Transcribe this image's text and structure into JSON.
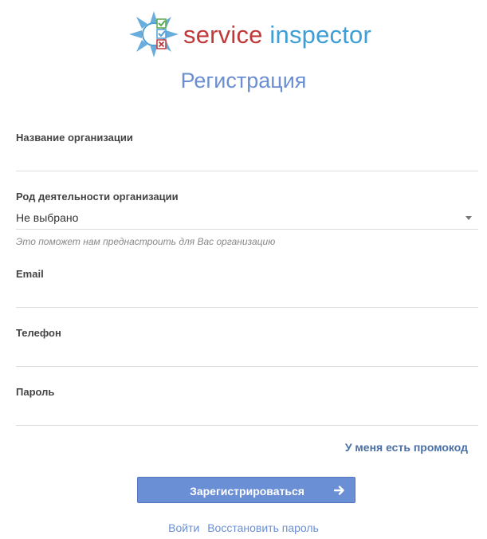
{
  "brand": {
    "word1": "service",
    "word2": "inspector"
  },
  "page": {
    "title": "Регистрация"
  },
  "form": {
    "org_name": {
      "label": "Название организации",
      "value": ""
    },
    "activity": {
      "label": "Род деятельности организации",
      "value": "Не выбрано",
      "hint": "Это поможет нам преднастроить для Вас организацию"
    },
    "email": {
      "label": "Email",
      "value": ""
    },
    "phone": {
      "label": "Телефон",
      "value": ""
    },
    "password": {
      "label": "Пароль",
      "value": ""
    }
  },
  "promo_link": "У меня есть промокод",
  "submit": {
    "label": "Зарегистрироваться",
    "icon": "arrow-right-icon"
  },
  "footer": {
    "login": "Войти",
    "restore": "Восстановить пароль"
  },
  "colors": {
    "accent": "#6b8fd4",
    "brand_red": "#c0393b",
    "brand_blue": "#3d9fd6",
    "link": "#4a6fa5"
  }
}
